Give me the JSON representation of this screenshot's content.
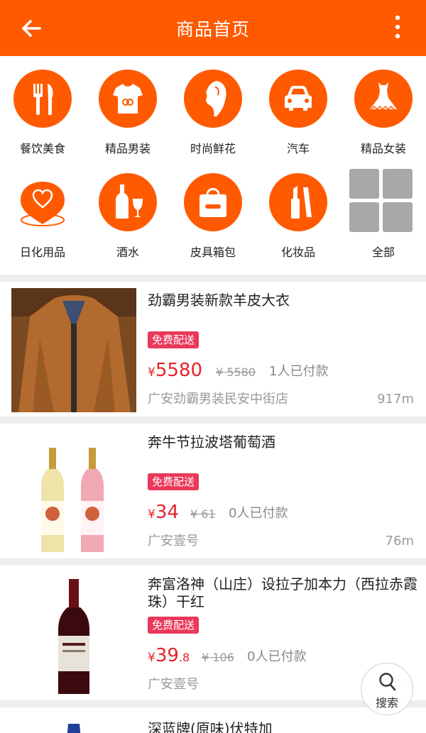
{
  "header": {
    "title": "商品首页"
  },
  "categories": [
    {
      "label": "餐饮美食",
      "icon": "fork-knife-icon"
    },
    {
      "label": "精品男装",
      "icon": "tshirt-icon"
    },
    {
      "label": "时尚鲜花",
      "icon": "fashion-face-icon"
    },
    {
      "label": "汽车",
      "icon": "car-icon"
    },
    {
      "label": "精品女装",
      "icon": "dress-icon"
    },
    {
      "label": "日化用品",
      "icon": "heart-bubble-icon"
    },
    {
      "label": "酒水",
      "icon": "wine-bottle-icon"
    },
    {
      "label": "皮具箱包",
      "icon": "handbag-icon"
    },
    {
      "label": "化妆品",
      "icon": "lipstick-icon"
    },
    {
      "label": "全部",
      "icon": "grid-icon"
    }
  ],
  "products": [
    {
      "name": "劲霸男装新款羊皮大衣",
      "badge": "免费配送",
      "price_yen": "¥",
      "price": "5580",
      "price_cents": "",
      "old_price": "¥ 5580",
      "paid": "1人已付款",
      "shop": "广安劲霸男装民安中街店",
      "distance": "917m"
    },
    {
      "name": "奔牛节拉波塔葡萄酒",
      "badge": "免费配送",
      "price_yen": "¥",
      "price": "34",
      "price_cents": "",
      "old_price": "¥ 61",
      "paid": "0人已付款",
      "shop": "广安壹号",
      "distance": "76m"
    },
    {
      "name": "奔富洛神（山庄）设拉子加本力（西拉赤霞珠）干红",
      "badge": "免费配送",
      "price_yen": "¥",
      "price": "39",
      "price_cents": ".8",
      "old_price": "¥ 106",
      "paid": "0人已付款",
      "shop": "广安壹号",
      "distance": "76m"
    },
    {
      "name": "深蓝牌(原味)伏特加"
    }
  ],
  "search_button": {
    "label": "搜索"
  },
  "colors": {
    "brand": "#ff5a00",
    "price": "#e5232a",
    "badge": "#e9385a"
  }
}
